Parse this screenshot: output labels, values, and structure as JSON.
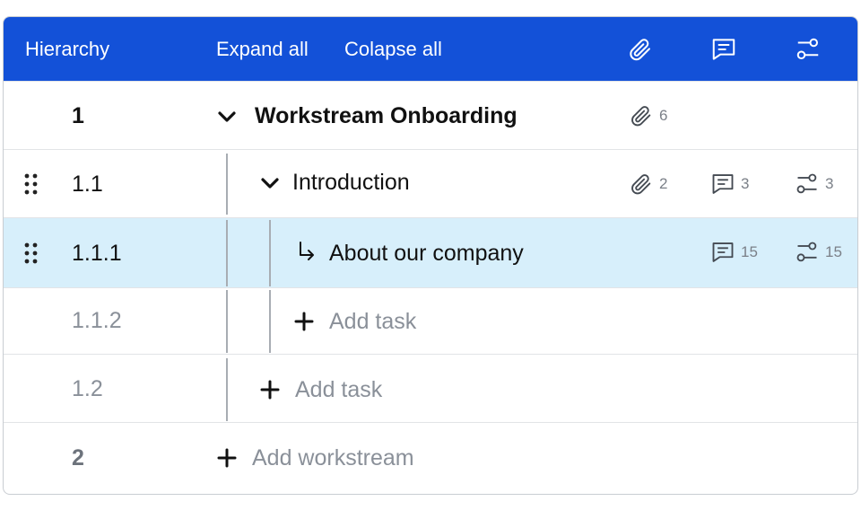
{
  "header": {
    "hierarchy_label": "Hierarchy",
    "expand_all_label": "Expand all",
    "collapse_all_label": "Colapse all",
    "icons": [
      "attachment-icon",
      "comment-icon",
      "workflow-icon"
    ]
  },
  "rows": [
    {
      "number": "1",
      "title": "Workstream Onboarding",
      "attachments": "6"
    },
    {
      "number": "1.1",
      "title": "Introduction",
      "attachments": "2",
      "comments": "3",
      "workflows": "3"
    },
    {
      "number": "1.1.1",
      "title": "About our company",
      "comments": "15",
      "workflows": "15"
    },
    {
      "number": "1.1.2",
      "add_label": "Add task"
    },
    {
      "number": "1.2",
      "add_label": "Add task"
    },
    {
      "number": "2",
      "add_label": "Add workstream"
    }
  ],
  "colors": {
    "header_bg": "#1351d8",
    "selected_row_bg": "#d7effb",
    "muted_text": "#8a9099"
  }
}
